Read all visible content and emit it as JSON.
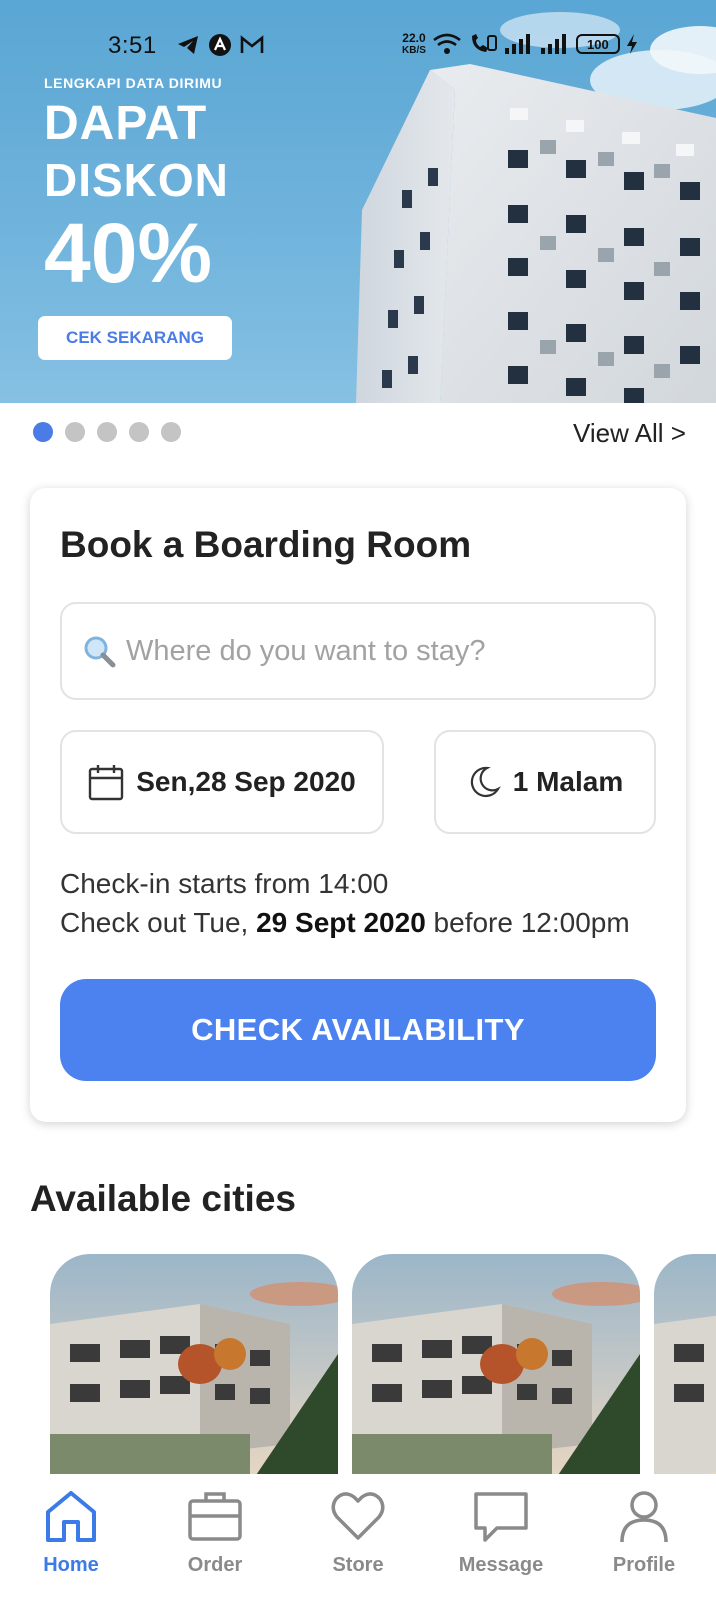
{
  "status_bar": {
    "time": "3:51",
    "net_speed_value": "22.0",
    "net_speed_unit": "KB/S",
    "battery": "100"
  },
  "banner": {
    "small_text": "LENGKAPI DATA DIRIMU",
    "line1": "DAPAT",
    "line2": "DISKON",
    "percent": "40%",
    "button_label": "CEK SEKARANG"
  },
  "carousel": {
    "view_all": "View All >",
    "total": 5,
    "active_index": 0
  },
  "booking": {
    "title": "Book a Boarding Room",
    "search_placeholder": "Where do you want to stay?",
    "date_label": "Sen,28 Sep 2020",
    "nights_label": "1 Malam",
    "checkin_text": "Check-in starts from 14:00",
    "checkout_prefix": "Check out Tue, ",
    "checkout_date": "29 Sept 2020",
    "checkout_suffix": " before 12:00pm",
    "button_label": "CHECK AVAILABILITY"
  },
  "cities": {
    "title": "Available cities"
  },
  "nav": {
    "items": [
      {
        "label": "Home",
        "icon": "home-icon",
        "active": true
      },
      {
        "label": "Order",
        "icon": "briefcase-icon",
        "active": false
      },
      {
        "label": "Store",
        "icon": "heart-icon",
        "active": false
      },
      {
        "label": "Message",
        "icon": "message-icon",
        "active": false
      },
      {
        "label": "Profile",
        "icon": "profile-icon",
        "active": false
      }
    ]
  },
  "colors": {
    "accent": "#4c82ef",
    "nav_active": "#3a7be8",
    "nav_inactive": "#8a8a8a",
    "banner_sky": "#6fb3dc"
  }
}
